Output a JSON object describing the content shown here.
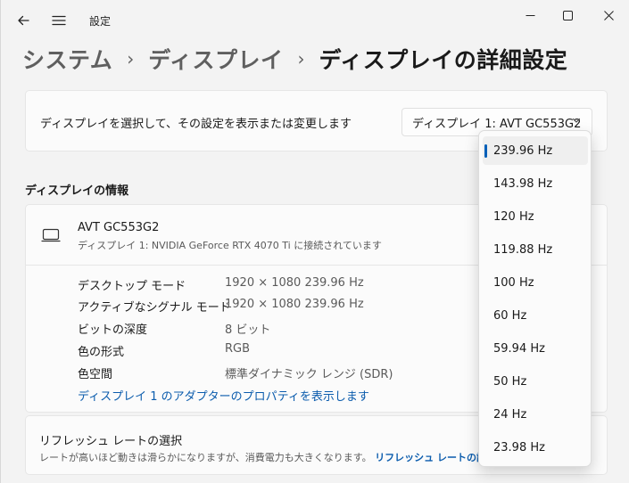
{
  "window": {
    "app_title": "設定",
    "icons": {
      "back": "back-arrow-icon",
      "menu": "hamburger-icon",
      "minimize": "minimize-icon",
      "maximize": "maximize-icon",
      "close": "close-icon"
    }
  },
  "breadcrumb": {
    "items": [
      "システム",
      "ディスプレイ",
      "ディスプレイの詳細設定"
    ],
    "separator": "›"
  },
  "display_select": {
    "label": "ディスプレイを選択して、その設定を表示または変更します",
    "selected": "ディスプレイ 1: AVT GC553G2"
  },
  "info_section": {
    "heading": "ディスプレイの情報",
    "monitor_name": "AVT GC553G2",
    "monitor_sub": "ディスプレイ 1: NVIDIA GeForce RTX 4070 Ti に接続されています",
    "properties": [
      {
        "key": "デスクトップ モード",
        "value": "1920 × 1080 239.96 Hz"
      },
      {
        "key": "アクティブなシグナル モード",
        "value": "1920 × 1080 239.96 Hz"
      },
      {
        "key": "ビットの深度",
        "value": "8 ビット"
      },
      {
        "key": "色の形式",
        "value": "RGB"
      },
      {
        "key": "色空間",
        "value": "標準ダイナミック レンジ (SDR)"
      }
    ],
    "adapter_link": "ディスプレイ 1 のアダプターのプロパティを表示します"
  },
  "refresh": {
    "title": "リフレッシュ レートの選択",
    "description": "レートが高いほど動きは滑らかになりますが、消費電力も大きくなります。",
    "link": "リフレッシュ レートの詳細"
  },
  "refresh_rates": {
    "options": [
      "239.96 Hz",
      "143.98 Hz",
      "120 Hz",
      "119.88 Hz",
      "100 Hz",
      "60 Hz",
      "59.94 Hz",
      "50 Hz",
      "24 Hz",
      "23.98 Hz"
    ],
    "selected_index": 0
  },
  "colors": {
    "accent": "#005fb8",
    "link": "#0b5cad"
  }
}
